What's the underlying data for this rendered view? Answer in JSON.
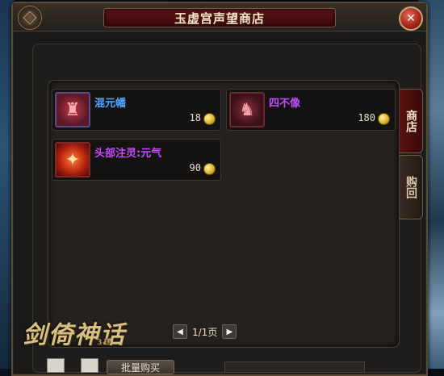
{
  "window": {
    "title": "玉虚宫声望商店",
    "close_glyph": "✕"
  },
  "tabs": [
    {
      "label": "商店",
      "active": true
    },
    {
      "label": "购回",
      "active": false
    }
  ],
  "items": [
    {
      "name": "混元幡",
      "price": "18",
      "name_color": "#4fa8ff",
      "icon": "banner-icon"
    },
    {
      "name": "四不像",
      "price": "180",
      "name_color": "#c24dff",
      "icon": "mount-icon"
    },
    {
      "name": "头部注灵:元气",
      "price": "90",
      "name_color": "#c24dff",
      "icon": "fire-spirit-icon"
    }
  ],
  "pager": {
    "prev": "◀",
    "text": "1/1页",
    "next": "▶"
  },
  "logo": {
    "text": "剑倚神话",
    "sub": "3D"
  },
  "bottom": {
    "button_label": "批量购买"
  }
}
